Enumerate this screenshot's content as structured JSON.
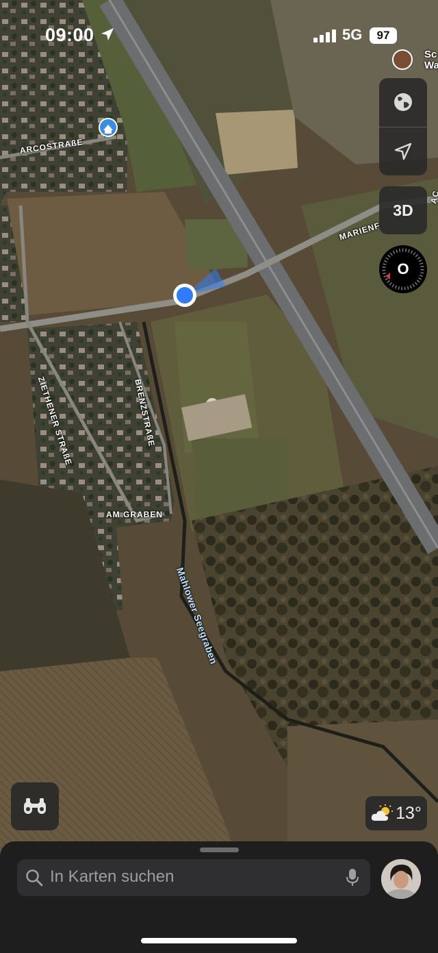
{
  "status_bar": {
    "time": "09:00",
    "network": "5G",
    "battery": "97"
  },
  "map": {
    "labels": {
      "arcostrasse": "ARCOSTRAßE",
      "marienfelder": "MARIENF",
      "ziethener": "ZIETHENER STRAßE",
      "brenzstrasse": "BRENZSTRAßE",
      "am_graben": "AM GRABEN",
      "mahlower": "Mahlower Seegraben",
      "poi_partial": "Sc",
      "poi_partial2": "Wa",
      "road_partial": "AC"
    }
  },
  "controls": {
    "btn_3d": "3D",
    "compass_letter": "O"
  },
  "weather": {
    "temperature": "13°"
  },
  "search": {
    "placeholder": "In Karten suchen"
  },
  "icons": {
    "location_arrow": "location-arrow-icon",
    "globe": "globe-icon",
    "navigation": "navigation-arrow-icon",
    "binoculars": "binoculars-icon",
    "weather": "partly-cloudy-icon",
    "search": "magnifier-icon",
    "mic": "microphone-icon"
  },
  "colors": {
    "location_dot": "#2f7cf6",
    "accent": "#2f7cf6"
  }
}
